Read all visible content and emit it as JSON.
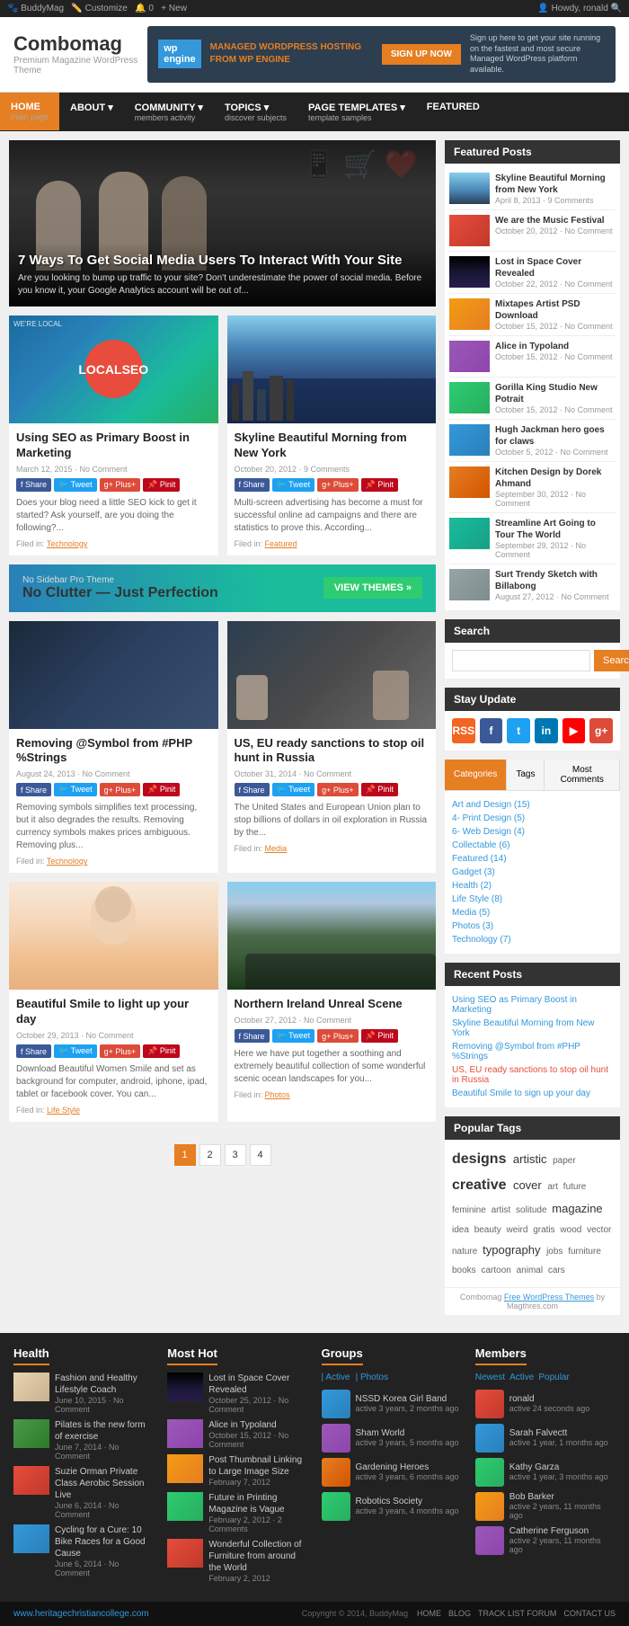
{
  "adminBar": {
    "left": "BuddyMag  Customize  0  + New",
    "right": "Howdy, ronald"
  },
  "header": {
    "title": "Combomag",
    "subtitle": "Premium Magazine WordPress Theme",
    "ad": {
      "logo": "wp engine",
      "headline": "MANAGED WORDPRESS HOSTING FROM WP ENGINE",
      "cta": "SIGN UP NOW",
      "sideText": "Sign up here to get your site running on the fastest and most secure Managed WordPress platform available."
    }
  },
  "nav": {
    "items": [
      {
        "label": "HOME",
        "sub": "main page",
        "active": true
      },
      {
        "label": "ABOUT",
        "sub": "",
        "active": false
      },
      {
        "label": "COMMUNITY",
        "sub": "members activity",
        "active": false
      },
      {
        "label": "TOPICS",
        "sub": "discover subjects",
        "active": false
      },
      {
        "label": "PAGE TEMPLATES",
        "sub": "template samples",
        "active": false
      },
      {
        "label": "FEATURED",
        "sub": "",
        "active": false
      }
    ]
  },
  "hero": {
    "title": "7 Ways To Get Social Media Users To Interact With Your Site",
    "excerpt": "Are you looking to bump up traffic to your site? Don't underestimate the power of social media. Before you know it, your Google Analytics account will be out of..."
  },
  "posts": [
    {
      "id": 1,
      "title": "Using SEO as Primary Boost in Marketing",
      "meta": "March 12, 2015 · No Comment",
      "excerpt": "Does your blog need a little SEO kick to get it started? Ask yourself, are you doing the following?...",
      "filed": "Technology",
      "thumbType": "seo"
    },
    {
      "id": 2,
      "title": "Skyline Beautiful Morning from New York",
      "meta": "October 20, 2012 · 9 Comments",
      "excerpt": "Multi-screen advertising has become a must for successful online ad campaigns and there are statistics to prove this. According...",
      "filed": "Featured",
      "thumbType": "city"
    },
    {
      "id": 3,
      "title": "Removing @Symbol from #PHP %Strings",
      "meta": "August 24, 2013 · No Comment",
      "excerpt": "Removing symbols simplifies text processing, but it also degrades the results. Removing currency symbols makes prices ambiguous. Removing plus...",
      "filed": "Technology",
      "thumbType": "php"
    },
    {
      "id": 4,
      "title": "US, EU ready sanctions to stop oil hunt in Russia",
      "meta": "October 31, 2014 · No Comment",
      "excerpt": "The United States and European Union plan to stop billions of dollars in oil exploration in Russia by the...",
      "filed": "Media",
      "thumbType": "russia"
    },
    {
      "id": 5,
      "title": "Beautiful Smile to light up your day",
      "meta": "October 29, 2013 · No Comment",
      "excerpt": "Download Beautiful Women Smile and set as background for computer, android, iphone, ipad, tablet or facebook cover. You can...",
      "filed": "Life Style",
      "thumbType": "smile"
    },
    {
      "id": 6,
      "title": "Northern Ireland Unreal Scene",
      "meta": "October 27, 2012 · No Comment",
      "excerpt": "Here we have put together a soothing and extremely beautiful collection of some wonderful scenic ocean landscapes for you...",
      "filed": "Photos",
      "thumbType": "ireland"
    }
  ],
  "bannerAd": {
    "label": "No Sidebar Pro Theme",
    "text": "No Clutter — Just Perfection",
    "cta": "VIEW THEMES »"
  },
  "sidebar": {
    "featuredTitle": "Featured Posts",
    "featuredPosts": [
      {
        "title": "Skyline Beautiful Morning from New York",
        "date": "April 8, 2013 · 9 Comments",
        "thumbClass": "ft-skyline"
      },
      {
        "title": "We are the Music Festival",
        "date": "October 20, 2012 · No Comment",
        "thumbClass": "ft-music"
      },
      {
        "title": "Lost in Space Cover Revealed",
        "date": "October 22, 2012 · No Comment",
        "thumbClass": "ft-space"
      },
      {
        "title": "Mixtapes Artist PSD Download",
        "date": "October 15, 2012 · No Comment",
        "thumbClass": "ft-mixtapes"
      },
      {
        "title": "Alice in Typoland",
        "date": "October 15, 2012 · No Comment",
        "thumbClass": "ft-alice"
      },
      {
        "title": "Gorilla King Studio New Potrait",
        "date": "October 15, 2012 · No Comment",
        "thumbClass": "ft-gorilla"
      },
      {
        "title": "Hugh Jackman hero goes for claws",
        "date": "October 5, 2012 · No Comment",
        "thumbClass": "ft-hugh"
      },
      {
        "title": "Kitchen Design by Dorek Ahmad",
        "date": "September 30, 2012 · No Comment",
        "thumbClass": "ft-kitchen"
      },
      {
        "title": "Streamline Art Going to Tour The World",
        "date": "September 29, 2012 · No Comment",
        "thumbClass": "ft-streamline"
      },
      {
        "title": "Surt Trendy Sketch with Billabong",
        "date": "August 27, 2012 · No Comment",
        "thumbClass": "ft-surt"
      }
    ],
    "searchPlaceholder": "",
    "searchBtn": "Search",
    "stayUpdateTitle": "Stay Update",
    "tabs": [
      "Categories",
      "Tags",
      "Most Comments"
    ],
    "categories": [
      "Art and Design (15)",
      "4- Print Design (5)",
      "6- Web Design (4)",
      "Collectable (6)",
      "Featured (14)",
      "Gadget (3)",
      "Health (2)",
      "Life Style (8)",
      "Media (5)",
      "Photos (3)",
      "Technology (7)"
    ],
    "recentTitle": "Recent Posts",
    "recentPosts": [
      {
        "title": "Using SEO as Primary Boost in Marketing",
        "highlight": false
      },
      {
        "title": "Skyline Beautiful Morning from New York",
        "highlight": false
      },
      {
        "title": "Removing @Symbol from #PHP %Strings",
        "highlight": false
      },
      {
        "title": "US, EU ready sanctions to stop oil hunt in Russia",
        "highlight": true
      },
      {
        "title": "Beautiful Smile to sign up your day",
        "highlight": false
      }
    ],
    "popularTagsTitle": "Popular Tags",
    "tags": [
      {
        "text": "designs",
        "size": "large"
      },
      {
        "text": "artistic",
        "size": "medium"
      },
      {
        "text": "paper",
        "size": "small"
      },
      {
        "text": "creative",
        "size": "large"
      },
      {
        "text": "cover",
        "size": "medium"
      },
      {
        "text": "art",
        "size": "small"
      },
      {
        "text": "future",
        "size": "small"
      },
      {
        "text": "feminine",
        "size": "small"
      },
      {
        "text": "artist",
        "size": "small"
      },
      {
        "text": "solitude",
        "size": "small"
      },
      {
        "text": "magazine",
        "size": "medium"
      },
      {
        "text": "idea",
        "size": "small"
      },
      {
        "text": "beauty",
        "size": "small"
      },
      {
        "text": "weird",
        "size": "small"
      },
      {
        "text": "gratis",
        "size": "small"
      },
      {
        "text": "wood",
        "size": "small"
      },
      {
        "text": "vector",
        "size": "small"
      },
      {
        "text": "nature",
        "size": "small"
      },
      {
        "text": "typography",
        "size": "medium"
      },
      {
        "text": "jobs",
        "size": "small"
      },
      {
        "text": "furniture",
        "size": "small"
      },
      {
        "text": "books",
        "size": "small"
      },
      {
        "text": "cartoon",
        "size": "small"
      },
      {
        "text": "animal",
        "size": "small"
      },
      {
        "text": "cars",
        "size": "small"
      }
    ],
    "footerNote": "Combomag Free WordPress Themes by Magthres.com"
  },
  "pagination": {
    "pages": [
      "1",
      "2",
      "3",
      "4"
    ],
    "current": "1"
  },
  "footer": {
    "healthTitle": "Health",
    "healthPosts": [
      {
        "title": "Fashion and Healthy Lifestyle Coach",
        "meta": "June 10, 2015 · No Comment",
        "thumbClass": "fth-fashion"
      },
      {
        "title": "Pilates is the new form of exercise",
        "meta": "June 7, 2014 · No Comment",
        "thumbClass": "fth-pilates"
      },
      {
        "title": "Suzie Orman Private Class Aerobic Session Live",
        "meta": "June 6, 2014 · No Comment",
        "thumbClass": "fth-suzie"
      },
      {
        "title": "Cycling for a Cure: 10 Bike Races for a Good Cause",
        "meta": "June 6, 2014 · No Comment",
        "thumbClass": "fth-cycling"
      }
    ],
    "mostHotTitle": "Most Hot",
    "mostHotPosts": [
      {
        "title": "Lost in Space Cover Revealed",
        "meta": "October 25, 2012 · No Comment",
        "thumbClass": "fth-lost"
      },
      {
        "title": "Alice in Typoland",
        "meta": "October 15, 2012 · No Comment",
        "thumbClass": "fth-alice"
      },
      {
        "title": "Post Thumbnail Linking to Large Image Size",
        "meta": "February 7, 2012",
        "thumbClass": "fth-post"
      },
      {
        "title": "Future in Printing Magazine is Vague",
        "meta": "February 2, 2012 · 2 Comments",
        "thumbClass": "fth-future"
      },
      {
        "title": "Wonderful Collection of Furniture from around the World",
        "meta": "February 2, 2012",
        "thumbClass": "fth-wonderful"
      }
    ],
    "groupsTitle": "Groups",
    "groupSubTabs": [
      "Active",
      "Photos"
    ],
    "groups": [
      {
        "name": "NSSD Korea Girl Band",
        "meta": "active 3 years, 2 months ago",
        "thumbClass": "fth-group1"
      },
      {
        "name": "Sham World",
        "meta": "active 3 years, 5 months ago",
        "thumbClass": "fth-group2"
      },
      {
        "name": "Gardening Heroes",
        "meta": "active 3 years, 6 months ago",
        "thumbClass": "fth-group3"
      },
      {
        "name": "Robotics Society",
        "meta": "active 3 years, 4 months ago",
        "thumbClass": "fth-group4"
      }
    ],
    "membersTitle": "Members",
    "memberTabs": [
      "Newest",
      "Active",
      "Popular"
    ],
    "members": [
      {
        "name": "ronald",
        "status": "active 24 seconds ago",
        "avatarClass": "ma-1"
      },
      {
        "name": "Sarah Falvectt",
        "status": "active 1 year, 1 months ago",
        "avatarClass": "ma-2"
      },
      {
        "name": "Kathy Garza",
        "status": "active 1 year, 3 months ago",
        "avatarClass": "ma-3"
      },
      {
        "name": "Bob Barker",
        "status": "active 2 years, 11 months ago",
        "avatarClass": "ma-4"
      },
      {
        "name": "Catherine Ferguson",
        "status": "active 2 years, 11 months ago",
        "avatarClass": "ma-5"
      }
    ],
    "url": "www.heritagechristiancollege.com",
    "copyright": "Copyright © 2014, BuddyMag",
    "footerLinks": [
      "HOME",
      "BLOG",
      "TRACK LIST FORUM",
      "CONTACT US"
    ]
  }
}
